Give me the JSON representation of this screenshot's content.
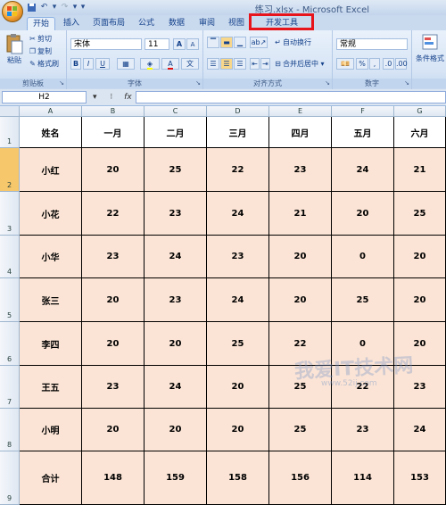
{
  "window": {
    "title": "练习.xlsx - Microsoft Excel"
  },
  "tabs": [
    {
      "label": "开始",
      "active": true
    },
    {
      "label": "插入"
    },
    {
      "label": "页面布局"
    },
    {
      "label": "公式"
    },
    {
      "label": "数据"
    },
    {
      "label": "审阅"
    },
    {
      "label": "视图"
    },
    {
      "label": "开发工具",
      "highlighted": true
    }
  ],
  "ribbon": {
    "clipboard": {
      "paste": "粘贴",
      "cut": "剪切",
      "copy": "复制",
      "format_painter": "格式刷",
      "label": "剪贴板"
    },
    "font": {
      "name": "宋体",
      "size": "11",
      "label": "字体",
      "bold": "B",
      "italic": "I",
      "underline": "U",
      "grow": "A",
      "shrink": "A",
      "font_color": "A"
    },
    "alignment": {
      "wrap": "自动换行",
      "merge": "合并后居中",
      "label": "对齐方式"
    },
    "number": {
      "format": "常规",
      "percent": "%",
      "comma": ",",
      "label": "数字"
    },
    "styles": {
      "conditional": "条件格式"
    }
  },
  "formula_bar": {
    "name_box": "H2",
    "fx": "fx",
    "content": ""
  },
  "columns": [
    "A",
    "B",
    "C",
    "D",
    "E",
    "F",
    "G"
  ],
  "rows": [
    "1",
    "2",
    "3",
    "4",
    "5",
    "6",
    "7",
    "8",
    "9"
  ],
  "table": {
    "header": [
      "姓名",
      "一月",
      "二月",
      "三月",
      "四月",
      "五月",
      "六月"
    ],
    "body": [
      [
        "小红",
        "20",
        "25",
        "22",
        "23",
        "24",
        "21"
      ],
      [
        "小花",
        "22",
        "23",
        "24",
        "21",
        "20",
        "25"
      ],
      [
        "小华",
        "23",
        "24",
        "23",
        "20",
        "0",
        "20"
      ],
      [
        "张三",
        "20",
        "23",
        "24",
        "20",
        "25",
        "20"
      ],
      [
        "李四",
        "20",
        "20",
        "25",
        "22",
        "0",
        "20"
      ],
      [
        "王五",
        "23",
        "24",
        "20",
        "25",
        "22",
        "23"
      ],
      [
        "小明",
        "20",
        "20",
        "20",
        "25",
        "23",
        "24"
      ],
      [
        "合计",
        "148",
        "159",
        "158",
        "156",
        "114",
        "153"
      ]
    ]
  },
  "watermark": {
    "text": "我爱IT技术网",
    "url": "www.52ij.com"
  }
}
